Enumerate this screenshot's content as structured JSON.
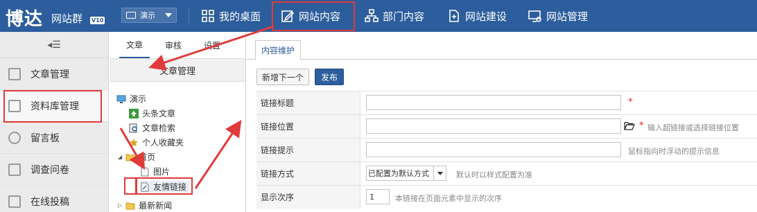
{
  "header": {
    "logo": "博达",
    "logo_sub": "网站群",
    "version": "V10",
    "site_select": "演示",
    "nav": [
      {
        "label": "我的桌面",
        "icon": "grid-icon"
      },
      {
        "label": "网站内容",
        "icon": "edit-icon"
      },
      {
        "label": "部门内容",
        "icon": "org-chart-icon"
      },
      {
        "label": "网站建设",
        "icon": "build-icon"
      },
      {
        "label": "网站管理",
        "icon": "monitor-gear-icon"
      }
    ]
  },
  "sidebar": {
    "collapse": "◂☰",
    "items": [
      {
        "label": "文章管理",
        "icon": "article-icon"
      },
      {
        "label": "资料库管理",
        "icon": "archive-icon"
      },
      {
        "label": "留言板",
        "icon": "message-icon"
      },
      {
        "label": "调查问卷",
        "icon": "survey-icon"
      },
      {
        "label": "在线投稿",
        "icon": "submit-icon"
      }
    ]
  },
  "tree": {
    "tabs": [
      "文章",
      "审核",
      "设置"
    ],
    "title": "文章管理",
    "nodes": [
      {
        "label": "演示",
        "icon": "monitor-icon"
      },
      {
        "label": "头条文章",
        "icon": "up-arrow-icon"
      },
      {
        "label": "文章检索",
        "icon": "search-doc-icon"
      },
      {
        "label": "个人收藏夹",
        "icon": "star-icon"
      },
      {
        "label": "首页",
        "icon": "folder-icon",
        "toggle": "◢"
      },
      {
        "label": "图片",
        "icon": "page-icon"
      },
      {
        "label": "友情链接",
        "icon": "link-page-icon"
      },
      {
        "label": "最新新闻",
        "icon": "folder-icon",
        "toggle": "▷"
      }
    ]
  },
  "main": {
    "tab": "内容维护",
    "btn_new": "新增下一个",
    "btn_publish": "发布",
    "rows": [
      {
        "label": "链接标题",
        "value": "",
        "required": "*",
        "hint": ""
      },
      {
        "label": "链接位置",
        "value": "",
        "required": "*",
        "hint": "输入超链接或选择链接位置"
      },
      {
        "label": "链接提示",
        "value": "",
        "required": "",
        "hint": "鼠标指向时浮动的提示信息"
      },
      {
        "label": "链接方式",
        "value": "已配置为默认方式",
        "required": "",
        "hint": "默认时以样式配置为准"
      },
      {
        "label": "显示次序",
        "value": "1",
        "required": "",
        "hint": "本链接在页面元素中显示的次序"
      }
    ]
  },
  "colors": {
    "header_bg": "#2c5d9c",
    "highlight_red": "#e03a3a"
  }
}
